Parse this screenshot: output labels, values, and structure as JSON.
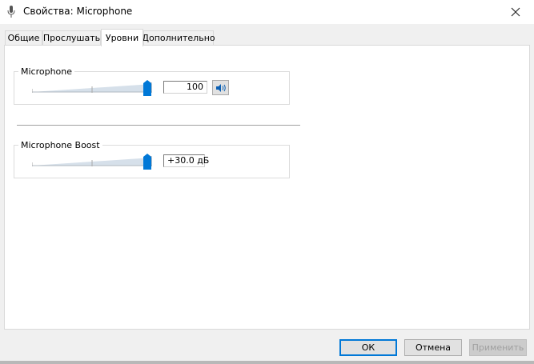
{
  "window": {
    "title": "Свойства: Microphone",
    "close_glyph": "✕"
  },
  "tabs": [
    {
      "label": "Общие",
      "active": false
    },
    {
      "label": "Прослушать",
      "active": false
    },
    {
      "label": "Уровни",
      "active": true
    },
    {
      "label": "Дополнительно",
      "active": false
    }
  ],
  "levels": {
    "microphone": {
      "label": "Microphone",
      "value": "100",
      "level": 1.0
    },
    "boost": {
      "label": "Microphone Boost",
      "value": "+30.0 дБ",
      "level": 1.0
    }
  },
  "buttons": {
    "ok": "ОК",
    "cancel": "Отмена",
    "apply": "Применить"
  },
  "colors": {
    "accent": "#0078d7",
    "thumb": "#0078d7"
  }
}
